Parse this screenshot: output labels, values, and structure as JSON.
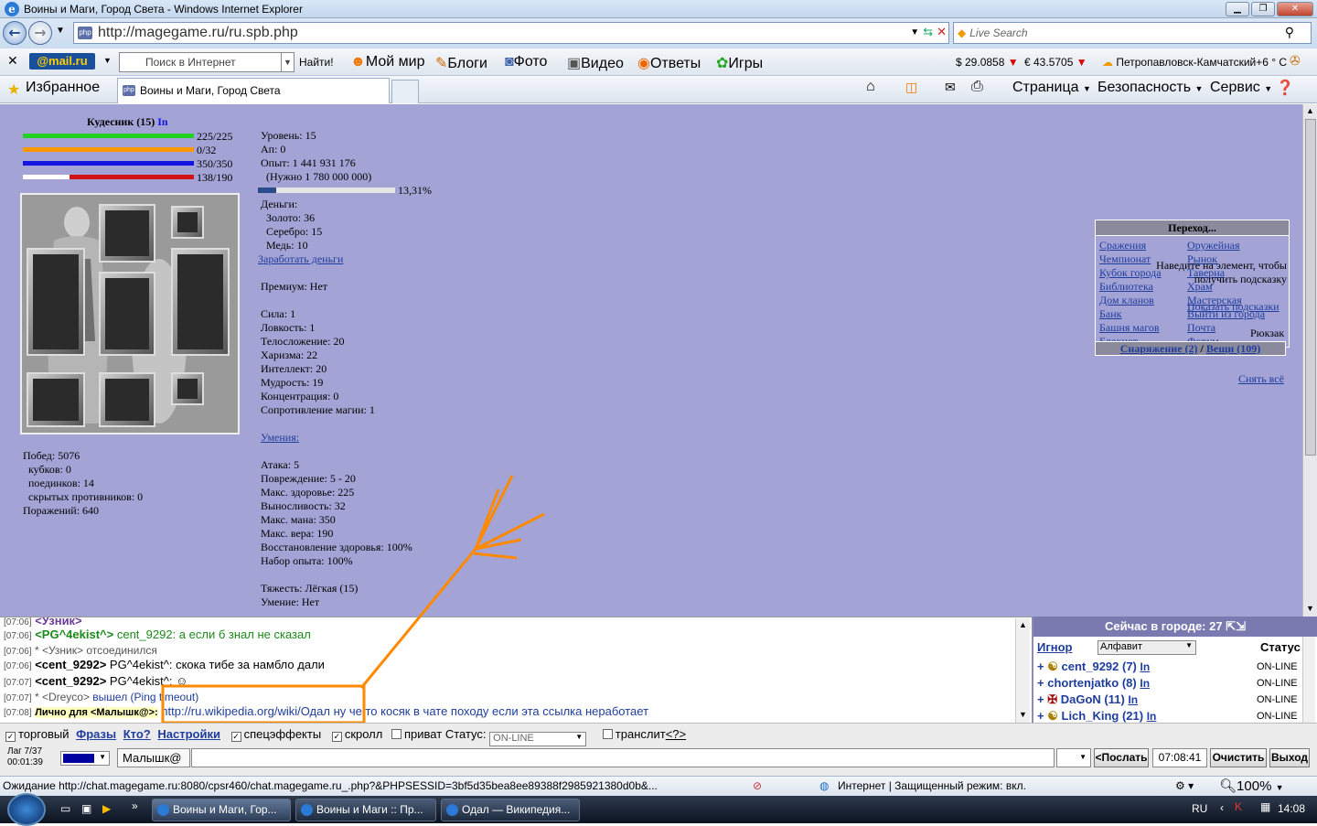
{
  "window": {
    "title": "Воины и Маги, Город Света - Windows Internet Explorer"
  },
  "address": {
    "url": "http://magegame.ru/ru.spb.php",
    "search_placeholder": "Live Search"
  },
  "toolbar2": {
    "mail_logo": "@mail.ru",
    "search_placeholder": "Поиск в Интернет",
    "find": "Найти!",
    "links": [
      "Мой мир",
      "Блоги",
      "Фото",
      "Видео",
      "Ответы",
      "Игры"
    ],
    "usd": "$ 29.0858",
    "eur": "€ 43.5705",
    "weather": "Петропавловск-Камчатский+6 ° С"
  },
  "toolbar3": {
    "favorites": "Избранное",
    "tab_title": "Воины и Маги, Город Света",
    "page": "Страница",
    "safety": "Безопасность",
    "service": "Сервис"
  },
  "character": {
    "name": "Кудесник (15)",
    "online": "In",
    "bars": [
      {
        "label": "225/225",
        "value": 1.0,
        "color": "#22d022"
      },
      {
        "label": "0/32",
        "value": 1.0,
        "color": "#ff9800"
      },
      {
        "label": "350/350",
        "value": 1.0,
        "color": "#1414e0"
      },
      {
        "label": "138/190",
        "value": 0.726,
        "color": "#d01414"
      }
    ],
    "record": [
      "Побед: 5076",
      "кубков: 0",
      "поединков: 14",
      "скрытых противников: 0",
      "Поражений: 640"
    ]
  },
  "stats": {
    "lines": [
      "Уровень: 15",
      "Ап: 0",
      "Опыт: 1 441 931 176",
      "(Нужно 1 780 000 000)"
    ],
    "exp_percent": "13,31%",
    "exp_fraction": 0.1331,
    "money": [
      "Деньги:",
      "Золото: 36",
      "Серебро: 15",
      "Медь: 10"
    ],
    "earn": "Заработать деньги",
    "premium": "Премиум: Нет",
    "attrs": [
      "Сила: 1",
      "Ловкость: 1",
      "Телосложение: 20",
      "Харизма: 22",
      "Интеллект: 20",
      "Мудрость: 19",
      "Концентрация: 0",
      "Сопротивление магии: 1"
    ],
    "skills": "Умения:",
    "combat": [
      "Атака: 5",
      "Повреждение: 5 - 20",
      "Макс. здоровье: 225",
      "Выносливость: 32",
      "Макс. мана: 350",
      "Макс. вера: 190",
      "Восстановление здоровья: 100%",
      "Набор опыта: 100%"
    ],
    "weight": [
      "Тяжесть: Лёгкая (15)",
      "Умение: Нет"
    ]
  },
  "nav": {
    "header": "Переход...",
    "left": [
      "Сражения",
      "Чемпионат",
      "Кубок города",
      "Библиотека",
      "Дом кланов",
      "Банк",
      "Башня магов",
      "Блокнот"
    ],
    "right": [
      "Оружейная",
      "Рынок",
      "Таверна",
      "Храм",
      "Мастерская",
      "Выйти из города",
      "Почта",
      "Форум"
    ]
  },
  "hint": {
    "text1": "Наведите на элемент, чтобы",
    "text2": "получить подсказку",
    "show": "Показать подсказки",
    "backpack": "Рюкзак",
    "equip": "Снаряжение (2)",
    "sep": "/",
    "items": "Вещи (109)",
    "remove_all": "Снять всё"
  },
  "chat": {
    "messages": [
      {
        "time": "[07:06]",
        "nick": "<PG^4ekist^>",
        "text": " cent_9292: а если б знал не сказал",
        "color": "#1a8a1a"
      },
      {
        "time": "[07:06]",
        "nick": "* <Узник>",
        "text": " отсоединился",
        "color": "#555"
      },
      {
        "time": "[07:06]",
        "nick": "<cent_9292>",
        "text": " PG^4ekist^: скока тибе за намбло дали",
        "color": "#000"
      },
      {
        "time": "[07:07]",
        "nick": "<cent_9292>",
        "text": " PG^4ekist^: ☺",
        "color": "#000"
      },
      {
        "time": "[07:07]",
        "nick": "* <Dreyco>",
        "text": " вышел (Ping timeout)",
        "color": "#555"
      },
      {
        "time": "[07:08]",
        "nick": "Лично для <Малышк@>:",
        "text": " http://ru.wikipedia.org/wiki/Одал ну че то косяк в чате походу если эта ссылка неработает",
        "color": "#1f3d9c"
      }
    ]
  },
  "users": {
    "header": "Сейчас в городе: 27",
    "ignore": "Игнор",
    "sort": "Алфавит",
    "status": "Статус",
    "list": [
      {
        "name": "cent_9292 (7)",
        "in": "In",
        "status": "ON-LINE"
      },
      {
        "name": "chortenjatko (8)",
        "in": "In",
        "status": "ON-LINE"
      },
      {
        "name": "DaGoN (11)",
        "in": "In",
        "status": "ON-LINE"
      },
      {
        "name": "Lich_King (21)",
        "in": "In",
        "status": "ON-LINE"
      }
    ]
  },
  "controls": {
    "trade": "торговый",
    "phrases": "Фразы",
    "who": "Кто?",
    "settings": "Настройки",
    "effects": "спецэффекты",
    "scroll": "скролл",
    "private": "приват",
    "status_label": "Статус:",
    "status_value": "ON-LINE",
    "translit": "транслит",
    "help": "<?>",
    "lag": "Лаг 7/37",
    "timer": "00:01:39",
    "nick": "Малышк@",
    "send": "<Послать",
    "time": "07:08:41",
    "clear": "Очистить",
    "exit": "Выход"
  },
  "statusbar": {
    "loading": "Ожидание http://chat.magegame.ru:8080/cpsr460/chat.magegame.ru_.php?&PHPSESSID=3bf5d35bea8ee89388f2985921380d0b&...",
    "zone": "Интернет | Защищенный режим: вкл.",
    "zoom": "100%"
  },
  "taskbar": {
    "tasks": [
      "Воины и Маги, Гор...",
      "Воины и Маги :: Пр...",
      "Одал — Википедия..."
    ],
    "lang": "RU",
    "clock": "14:08"
  },
  "colors": {
    "game_bg": "#a3a3d6",
    "annotation": "#ff8a00"
  }
}
